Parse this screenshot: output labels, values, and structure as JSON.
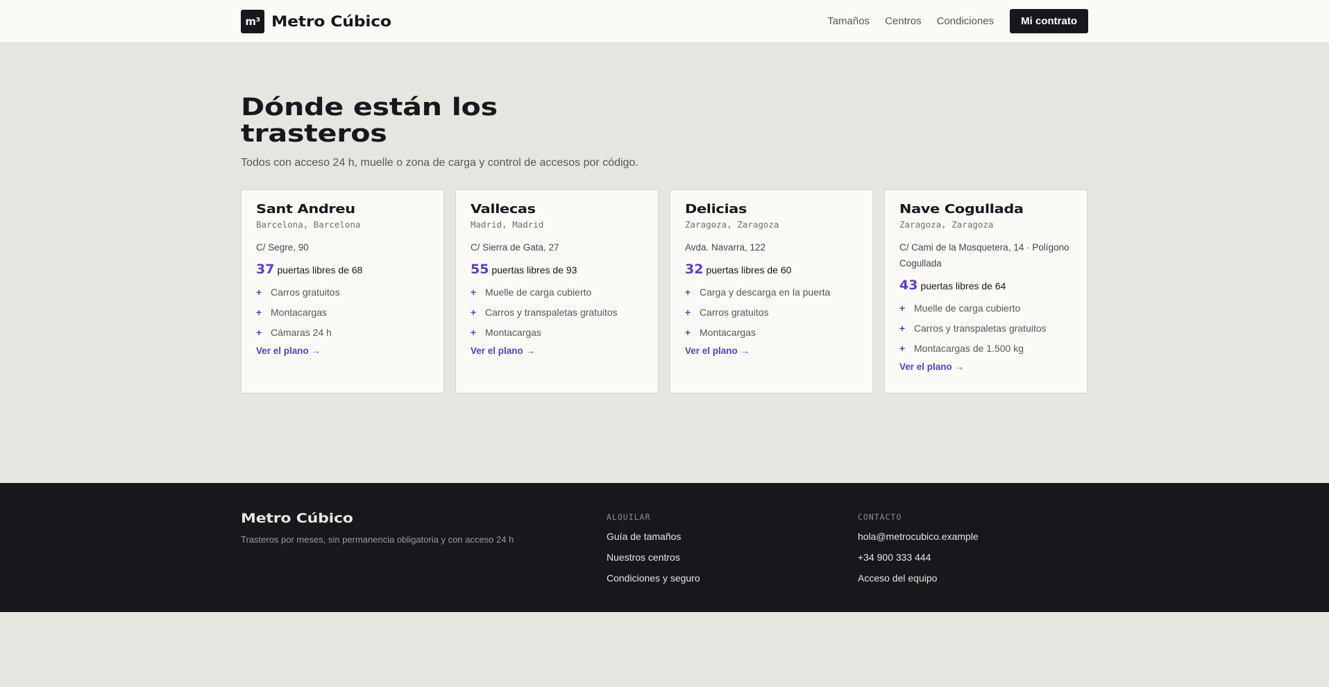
{
  "header": {
    "logo_mark": "m³",
    "brand": "Metro Cúbico",
    "nav": [
      "Tamaños",
      "Centros",
      "Condiciones"
    ],
    "cta": "Mi contrato"
  },
  "hero": {
    "title": "Dónde están los trasteros",
    "subtitle": "Todos con acceso 24 h, muelle o zona de carga y control de accesos por código."
  },
  "centers": [
    {
      "name": "Sant Andreu",
      "city": "Barcelona, Barcelona",
      "address": "C/ Segre, 90",
      "free": "37",
      "free_label": "puertas libres de 68",
      "features": [
        "Carros gratuitos",
        "Montacargas",
        "Cámaras 24 h"
      ],
      "link": "Ver el plano →"
    },
    {
      "name": "Vallecas",
      "city": "Madrid, Madrid",
      "address": "C/ Sierra de Gata, 27",
      "free": "55",
      "free_label": "puertas libres de 93",
      "features": [
        "Muelle de carga cubierto",
        "Carros y transpaletas gratuitos",
        "Montacargas"
      ],
      "link": "Ver el plano →"
    },
    {
      "name": "Delicias",
      "city": "Zaragoza, Zaragoza",
      "address": "Avda. Navarra, 122",
      "free": "32",
      "free_label": "puertas libres de 60",
      "features": [
        "Carga y descarga en la puerta",
        "Carros gratuitos",
        "Montacargas"
      ],
      "link": "Ver el plano →"
    },
    {
      "name": "Nave Cogullada",
      "city": "Zaragoza, Zaragoza",
      "address": "C/ Cami de la Mosquetera, 14 · Polígono Cogullada",
      "free": "43",
      "free_label": "puertas libres de 64",
      "features": [
        "Muelle de carga cubierto",
        "Carros y transpaletas gratuitos",
        "Montacargas de 1.500 kg"
      ],
      "link": "Ver el plano →"
    }
  ],
  "footer": {
    "brand": "Metro Cúbico",
    "tagline": "Trasteros por meses, sin permanencia obligatoria y con acceso 24 h",
    "rent_heading": "ALQUILAR",
    "rent_links": [
      "Guía de tamaños",
      "Nuestros centros",
      "Condiciones y seguro"
    ],
    "contact_heading": "CONTACTO",
    "contact_links": [
      "hola@metrocubico.example",
      "+34 900 333 444",
      "Acceso del equipo"
    ]
  },
  "colors": {
    "accent": "#5a3fc0",
    "dark": "#17181c",
    "background": "#e6e5e0",
    "card": "#fbfaf7"
  }
}
